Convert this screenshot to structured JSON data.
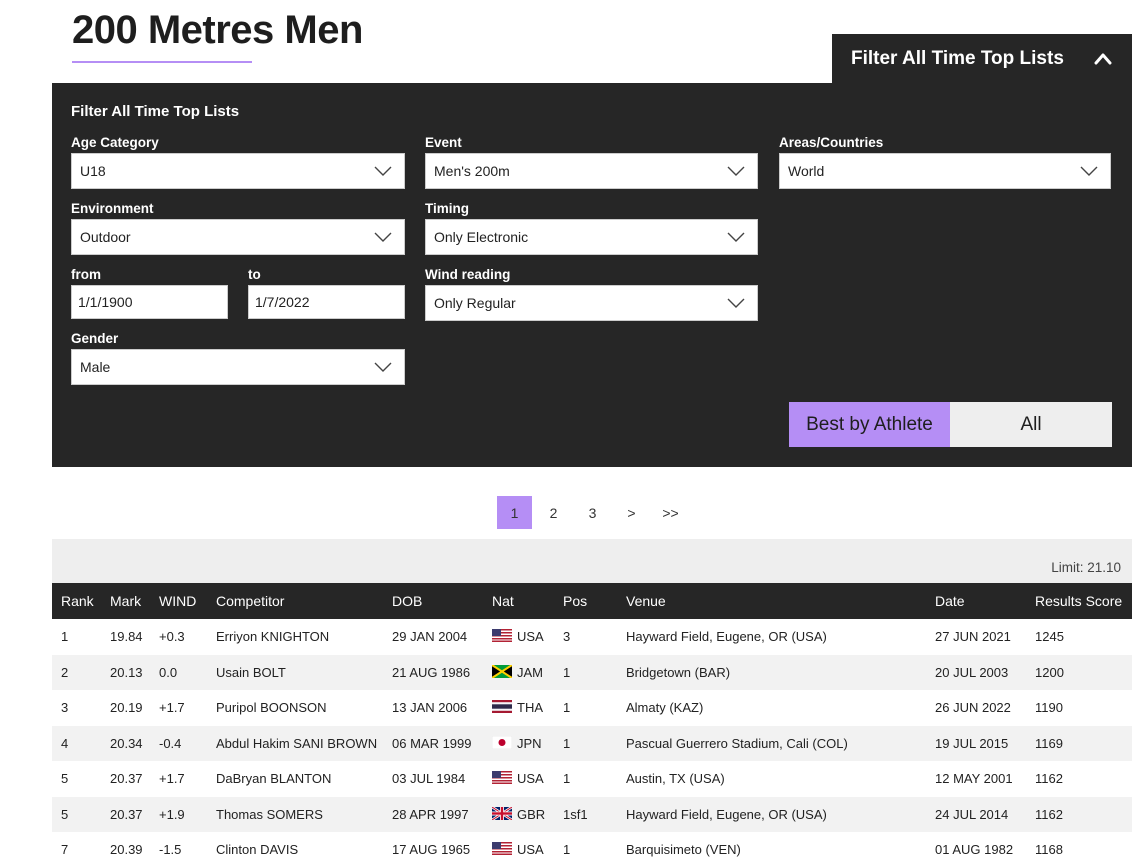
{
  "page": {
    "title": "200 Metres Men"
  },
  "filter": {
    "toggle_label": "Filter All Time Top Lists",
    "heading": "Filter All Time Top Lists",
    "age_category": {
      "label": "Age Category",
      "value": "U18"
    },
    "event": {
      "label": "Event",
      "value": "Men's 200m"
    },
    "areas": {
      "label": "Areas/Countries",
      "value": "World"
    },
    "environment": {
      "label": "Environment",
      "value": "Outdoor"
    },
    "timing": {
      "label": "Timing",
      "value": "Only Electronic"
    },
    "from": {
      "label": "from",
      "value": "1/1/1900"
    },
    "to": {
      "label": "to",
      "value": "1/7/2022"
    },
    "wind": {
      "label": "Wind reading",
      "value": "Only Regular"
    },
    "gender": {
      "label": "Gender",
      "value": "Male"
    },
    "best_by_athlete_label": "Best by Athlete",
    "all_label": "All"
  },
  "pagination": {
    "pages": [
      "1",
      "2",
      "3"
    ],
    "next": ">",
    "last": ">>",
    "current": "1"
  },
  "limit": "Limit: 21.10",
  "table": {
    "headers": [
      "Rank",
      "Mark",
      "WIND",
      "Competitor",
      "DOB",
      "Nat",
      "Pos",
      "Venue",
      "Date",
      "Results Score"
    ],
    "rows": [
      {
        "rank": "1",
        "mark": "19.84",
        "wind": "+0.3",
        "competitor": "Erriyon KNIGHTON",
        "dob": "29 JAN 2004",
        "nat": "USA",
        "flag": "usa-flag-icon",
        "pos": "3",
        "venue": "Hayward Field, Eugene, OR (USA)",
        "date": "27 JUN 2021",
        "score": "1245"
      },
      {
        "rank": "2",
        "mark": "20.13",
        "wind": "0.0",
        "competitor": "Usain BOLT",
        "dob": "21 AUG 1986",
        "nat": "JAM",
        "flag": "jam-flag-icon",
        "pos": "1",
        "venue": "Bridgetown (BAR)",
        "date": "20 JUL 2003",
        "score": "1200"
      },
      {
        "rank": "3",
        "mark": "20.19",
        "wind": "+1.7",
        "competitor": "Puripol BOONSON",
        "dob": "13 JAN 2006",
        "nat": "THA",
        "flag": "tha-flag-icon",
        "pos": "1",
        "venue": "Almaty (KAZ)",
        "date": "26 JUN 2022",
        "score": "1190"
      },
      {
        "rank": "4",
        "mark": "20.34",
        "wind": "-0.4",
        "competitor": "Abdul Hakim SANI BROWN",
        "dob": "06 MAR 1999",
        "nat": "JPN",
        "flag": "jpn-flag-icon",
        "pos": "1",
        "venue": "Pascual Guerrero Stadium, Cali (COL)",
        "date": "19 JUL 2015",
        "score": "1169"
      },
      {
        "rank": "5",
        "mark": "20.37",
        "wind": "+1.7",
        "competitor": "DaBryan BLANTON",
        "dob": "03 JUL 1984",
        "nat": "USA",
        "flag": "usa-flag-icon",
        "pos": "1",
        "venue": "Austin, TX (USA)",
        "date": "12 MAY 2001",
        "score": "1162"
      },
      {
        "rank": "5",
        "mark": "20.37",
        "wind": "+1.9",
        "competitor": "Thomas SOMERS",
        "dob": "28 APR 1997",
        "nat": "GBR",
        "flag": "gbr-flag-icon",
        "pos": "1sf1",
        "venue": "Hayward Field, Eugene, OR (USA)",
        "date": "24 JUL 2014",
        "score": "1162"
      },
      {
        "rank": "7",
        "mark": "20.39",
        "wind": "-1.5",
        "competitor": "Clinton DAVIS",
        "dob": "17 AUG 1965",
        "nat": "USA",
        "flag": "usa-flag-icon",
        "pos": "1",
        "venue": "Barquisimeto (VEN)",
        "date": "01 AUG 1982",
        "score": "1168"
      }
    ]
  },
  "colors": {
    "accent": "#b58ef5",
    "panel": "#262626",
    "stripe": "#f2f2f2"
  }
}
